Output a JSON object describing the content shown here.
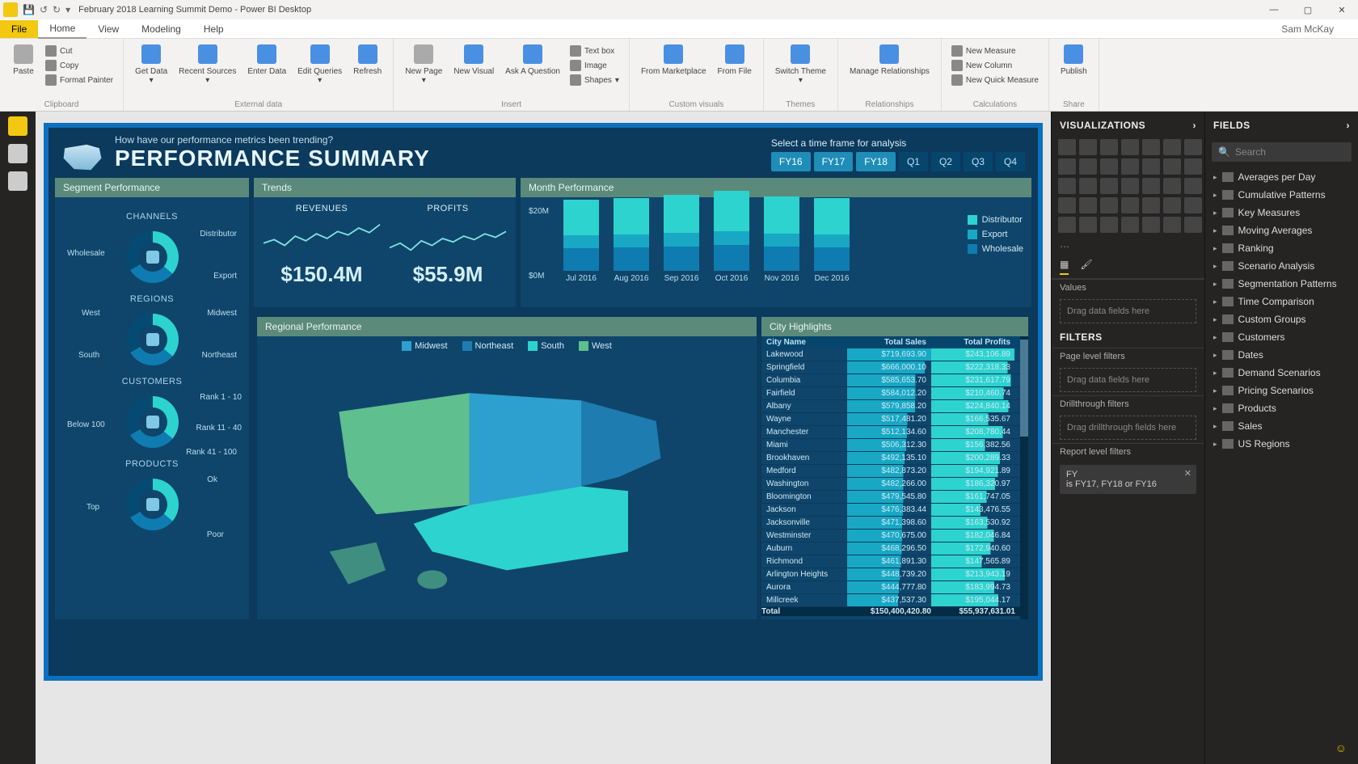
{
  "window": {
    "title": "February 2018 Learning Summit Demo - Power BI Desktop",
    "user": "Sam McKay"
  },
  "qat": {
    "save": "💾",
    "undo": "↺",
    "redo": "↻",
    "dd": "▾"
  },
  "wincontrols": {
    "min": "—",
    "max": "▢",
    "close": "✕"
  },
  "menubar": {
    "file": "File",
    "home": "Home",
    "view": "View",
    "modeling": "Modeling",
    "help": "Help"
  },
  "ribbon": {
    "clipboard": {
      "label": "Clipboard",
      "paste": "Paste",
      "cut": "Cut",
      "copy": "Copy",
      "fmt": "Format Painter"
    },
    "external": {
      "label": "External data",
      "getdata": "Get Data",
      "recent": "Recent Sources",
      "enter": "Enter Data",
      "edit": "Edit Queries",
      "refresh": "Refresh"
    },
    "insert": {
      "label": "Insert",
      "newpage": "New Page",
      "newvisual": "New Visual",
      "ask": "Ask A Question",
      "textbox": "Text box",
      "image": "Image",
      "shapes": "Shapes"
    },
    "custom": {
      "label": "Custom visuals",
      "market": "From Marketplace",
      "file": "From File"
    },
    "themes": {
      "label": "Themes",
      "switch": "Switch Theme"
    },
    "rel": {
      "label": "Relationships",
      "manage": "Manage Relationships"
    },
    "calc": {
      "label": "Calculations",
      "measure": "New Measure",
      "column": "New Column",
      "quick": "New Quick Measure"
    },
    "share": {
      "label": "Share",
      "publish": "Publish"
    }
  },
  "header": {
    "subtitle": "How have our performance metrics been trending?",
    "title": "PERFORMANCE SUMMARY",
    "timeframe_label": "Select a time frame for analysis",
    "buttons": [
      "FY16",
      "FY17",
      "FY18",
      "Q1",
      "Q2",
      "Q3",
      "Q4"
    ]
  },
  "panels": {
    "segment": "Segment Performance",
    "trends": "Trends",
    "month": "Month Performance",
    "regional": "Regional Performance",
    "city": "City Highlights"
  },
  "segment": {
    "channels": {
      "title": "CHANNELS",
      "labels": [
        "Distributor",
        "Export",
        "Wholesale"
      ]
    },
    "regions": {
      "title": "REGIONS",
      "labels": [
        "Midwest",
        "Northeast",
        "South",
        "West"
      ]
    },
    "customers": {
      "title": "CUSTOMERS",
      "labels": [
        "Rank 1 - 10",
        "Rank 11 - 40",
        "Rank 41 - 100",
        "Below 100"
      ]
    },
    "products": {
      "title": "PRODUCTS",
      "labels": [
        "Ok",
        "Poor",
        "Top"
      ]
    }
  },
  "trends": {
    "revenues": {
      "title": "REVENUES",
      "value": "$150.4M"
    },
    "profits": {
      "title": "PROFITS",
      "value": "$55.9M"
    }
  },
  "month": {
    "y20": "$20M",
    "y0": "$0M",
    "legend": [
      "Distributor",
      "Export",
      "Wholesale"
    ],
    "colors": [
      "#2dd3cf",
      "#18a8c4",
      "#0e7cb0"
    ]
  },
  "map_legend": [
    "Midwest",
    "Northeast",
    "South",
    "West"
  ],
  "city": {
    "cols": [
      "City Name",
      "Total Sales",
      "Total Profits"
    ],
    "rows": [
      [
        "Lakewood",
        "$719,693.90",
        "$243,106.89"
      ],
      [
        "Springfield",
        "$666,000.10",
        "$222,318.33"
      ],
      [
        "Columbia",
        "$585,653.70",
        "$231,617.79"
      ],
      [
        "Fairfield",
        "$584,012.20",
        "$210,460.74"
      ],
      [
        "Albany",
        "$579,858.20",
        "$224,840.14"
      ],
      [
        "Wayne",
        "$517,481.20",
        "$166,535.67"
      ],
      [
        "Manchester",
        "$512,134.60",
        "$208,780.44"
      ],
      [
        "Miami",
        "$506,312.30",
        "$156,382.56"
      ],
      [
        "Brookhaven",
        "$492,135.10",
        "$200,289.33"
      ],
      [
        "Medford",
        "$482,873.20",
        "$194,921.89"
      ],
      [
        "Washington",
        "$482,266.00",
        "$186,320.97"
      ],
      [
        "Bloomington",
        "$479,545.80",
        "$161,747.05"
      ],
      [
        "Jackson",
        "$476,383.44",
        "$143,476.55"
      ],
      [
        "Jacksonville",
        "$471,398.60",
        "$163,530.92"
      ],
      [
        "Westminster",
        "$470,675.00",
        "$182,046.84"
      ],
      [
        "Auburn",
        "$468,296.50",
        "$172,940.60"
      ],
      [
        "Richmond",
        "$461,891.30",
        "$147,565.89"
      ],
      [
        "Arlington Heights",
        "$448,739.20",
        "$213,943.19"
      ],
      [
        "Aurora",
        "$444,777.80",
        "$183,994.73"
      ],
      [
        "Millcreek",
        "$437,537.30",
        "$195,044.17"
      ]
    ],
    "total": [
      "Total",
      "$150,400,420.80",
      "$55,937,631.01"
    ]
  },
  "vizpane": {
    "title": "VISUALIZATIONS",
    "values": "Values",
    "drop1": "Drag data fields here",
    "filters": "FILTERS",
    "pagefilters": "Page level filters",
    "drop2": "Drag data fields here",
    "drill": "Drillthrough filters",
    "drop3": "Drag drillthrough fields here",
    "reportfilters": "Report level filters",
    "chip_label": "FY",
    "chip_sub": "is FY17, FY18 or FY16"
  },
  "fieldspane": {
    "title": "FIELDS",
    "search_ph": "Search",
    "items": [
      "Averages per Day",
      "Cumulative Patterns",
      "Key Measures",
      "Moving Averages",
      "Ranking",
      "Scenario Analysis",
      "Segmentation Patterns",
      "Time Comparison",
      "Custom Groups",
      "Customers",
      "Dates",
      "Demand Scenarios",
      "Pricing Scenarios",
      "Products",
      "Sales",
      "US Regions"
    ]
  },
  "chart_data": {
    "month_bars": {
      "type": "bar",
      "stacked": true,
      "ylabel": "",
      "ylim": [
        0,
        25000000
      ],
      "categories": [
        "Jul 2016",
        "Aug 2016",
        "Sep 2016",
        "Oct 2016",
        "Nov 2016",
        "Dec 2016"
      ],
      "series": [
        {
          "name": "Wholesale",
          "values": [
            7000000,
            7200000,
            7600000,
            8000000,
            7400000,
            7300000
          ]
        },
        {
          "name": "Export",
          "values": [
            4000000,
            4100000,
            4200000,
            4300000,
            4000000,
            3900000
          ]
        },
        {
          "name": "Distributor",
          "values": [
            11000000,
            11300000,
            11800000,
            12400000,
            11500000,
            11200000
          ]
        }
      ]
    },
    "donuts": {
      "channels": {
        "labels": [
          "Distributor",
          "Export",
          "Wholesale"
        ],
        "values": [
          45,
          25,
          30
        ]
      },
      "regions": {
        "labels": [
          "Midwest",
          "Northeast",
          "South",
          "West"
        ],
        "values": [
          30,
          22,
          26,
          22
        ]
      },
      "customers": {
        "labels": [
          "Rank 1 - 10",
          "Rank 11 - 40",
          "Rank 41 - 100",
          "Below 100"
        ],
        "values": [
          20,
          28,
          30,
          22
        ]
      },
      "products": {
        "labels": [
          "Ok",
          "Poor",
          "Top"
        ],
        "values": [
          40,
          25,
          35
        ]
      }
    },
    "sparklines": {
      "revenues": [
        42,
        45,
        40,
        48,
        44,
        50,
        46,
        52,
        49,
        55,
        51,
        58
      ],
      "profits": [
        38,
        42,
        36,
        44,
        40,
        46,
        43,
        48,
        45,
        50,
        47,
        52
      ]
    }
  }
}
